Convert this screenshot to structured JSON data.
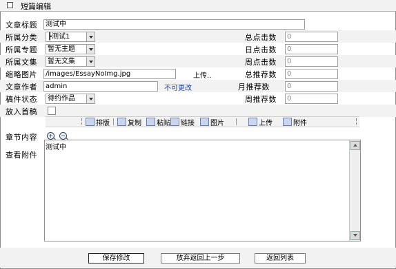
{
  "title": "短篇编辑",
  "fields": {
    "article_title": {
      "label": "文章标题",
      "value": "测试中"
    },
    "category": {
      "label": "所属分类",
      "value": "┣测试1"
    },
    "topic": {
      "label": "所属专题",
      "value": "暂无主题"
    },
    "collection": {
      "label": "所属文集",
      "value": "暂无文集"
    },
    "thumbnail": {
      "label": "缩略图片",
      "value": "/images/EssayNoImg.jpg",
      "upload": "上传.."
    },
    "author": {
      "label": "文章作者",
      "value": "admin",
      "link": "不可更改"
    },
    "status": {
      "label": "稿件状态",
      "value": "待约作品"
    },
    "homepage": {
      "label": "放入首稿"
    }
  },
  "stats": {
    "total_clicks": {
      "label": "总点击数",
      "value": "0"
    },
    "day_clicks": {
      "label": "日点击数",
      "value": "0"
    },
    "week_clicks": {
      "label": "周点击数",
      "value": "0"
    },
    "total_recommend": {
      "label": "总推荐数",
      "value": "0"
    },
    "month_recommend": {
      "label": "月推荐数",
      "value": "0"
    },
    "week_recommend": {
      "label": "周推荐数",
      "value": "0"
    }
  },
  "toolbar": {
    "layout": "排版",
    "copy": "复制",
    "paste": "粘贴",
    "link": "链接",
    "image": "图片",
    "upload": "上传",
    "attachment": "附件"
  },
  "content": {
    "label": "章节内容",
    "attachments_label": "查看附件",
    "text": "测试中"
  },
  "buttons": {
    "save": "保存修改",
    "back": "放弃返回上一步",
    "list": "返回列表"
  }
}
